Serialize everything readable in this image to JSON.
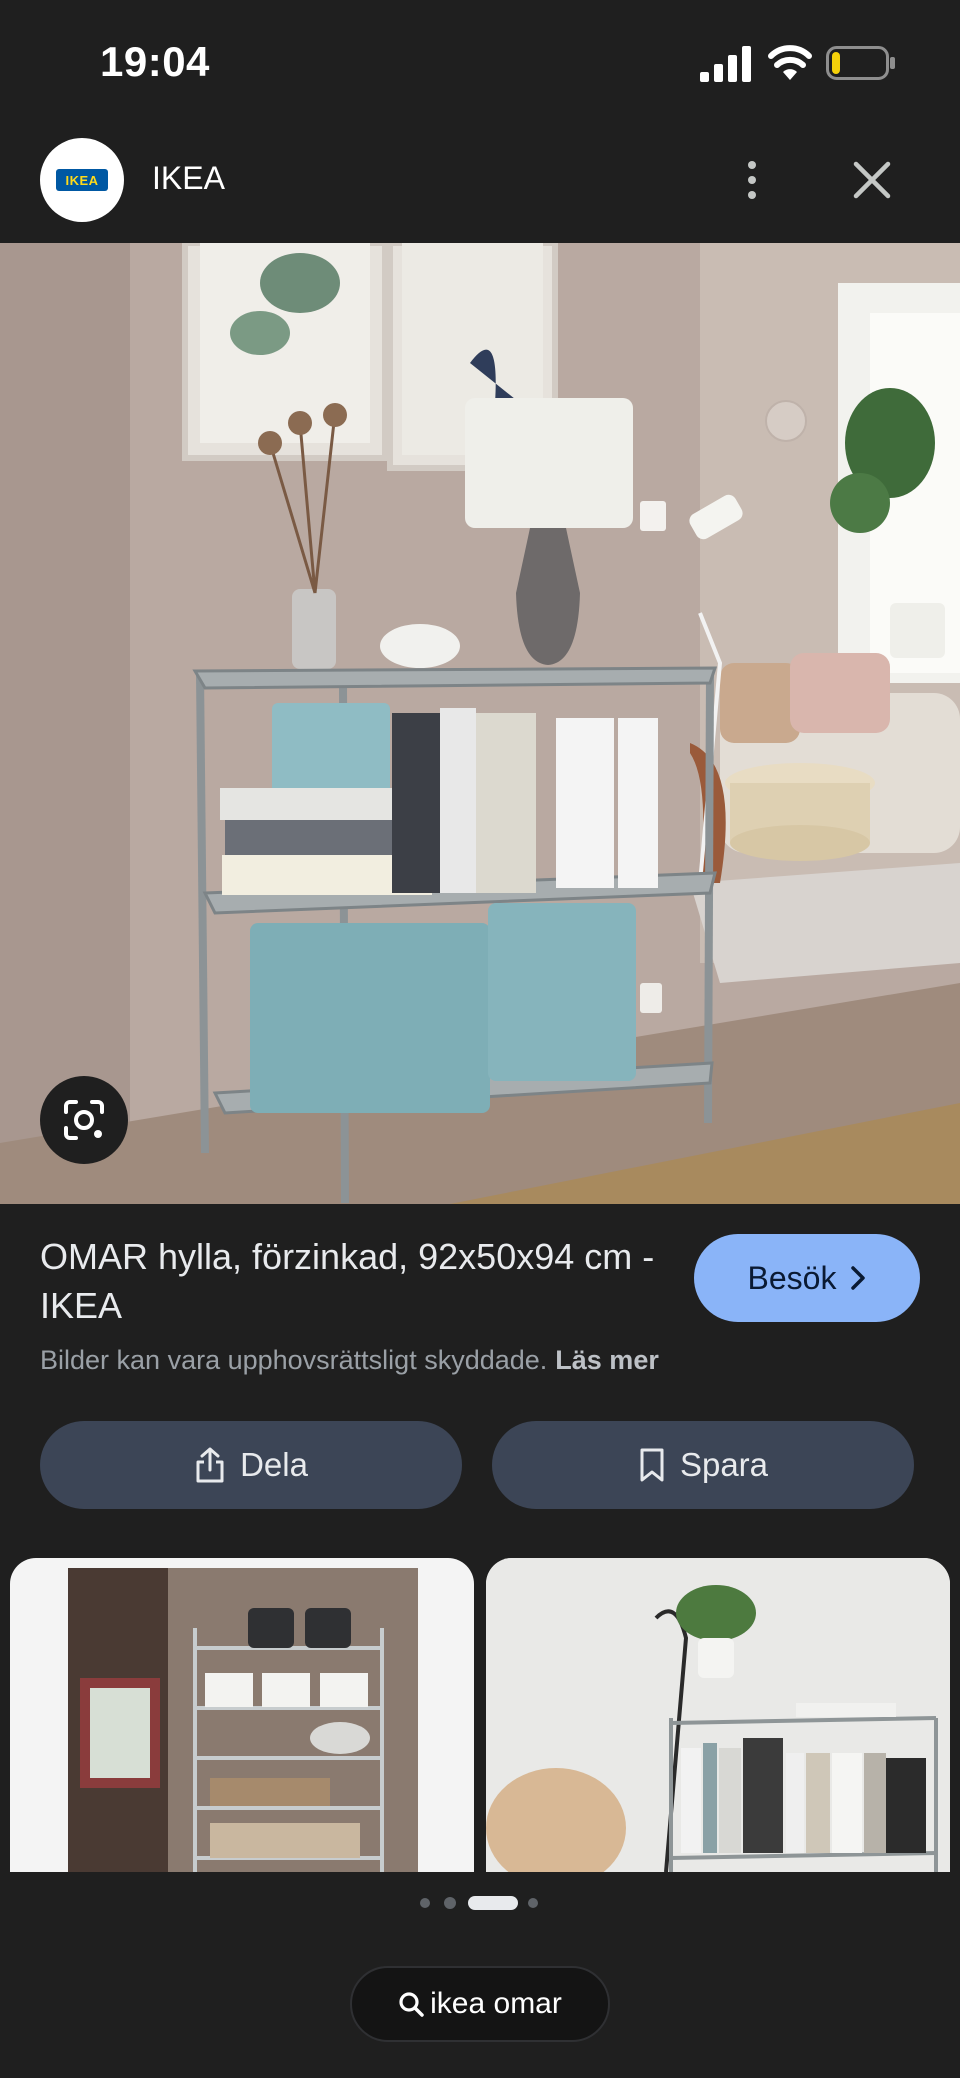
{
  "status_bar": {
    "time": "19:04",
    "signal_icon": "cellular-signal-icon",
    "wifi_icon": "wifi-icon",
    "battery_icon": "battery-low-icon",
    "battery_level": 0.15,
    "battery_color": "#f5d10a"
  },
  "header": {
    "site_name": "IKEA",
    "logo_text": "IKEA",
    "logo_colors": {
      "blue": "#0058a3",
      "yellow": "#ffda1a"
    },
    "more_icon": "more-vertical-icon",
    "close_icon": "close-icon"
  },
  "hero": {
    "lens_icon": "google-lens-icon"
  },
  "result": {
    "title": "OMAR hylla, förzinkad, 92x50x94 cm - IKEA",
    "visit_label": "Besök",
    "visit_icon": "chevron-right-icon",
    "copyright_text": "Bilder kan vara upphovsrättsligt skyddade.",
    "read_more": "Läs mer"
  },
  "actions": {
    "share_label": "Dela",
    "share_icon": "share-icon",
    "save_label": "Spara",
    "save_icon": "bookmark-icon"
  },
  "related": [
    {
      "name": "related-image-pantry-shelf"
    },
    {
      "name": "related-image-book-shelf"
    }
  ],
  "pager": {
    "count": 4,
    "active_index": 2
  },
  "search": {
    "query": "ikea omar",
    "icon": "search-icon"
  },
  "colors": {
    "background": "#1f1f1f",
    "accent": "#8ab4f8",
    "chip": "#3c4556"
  }
}
